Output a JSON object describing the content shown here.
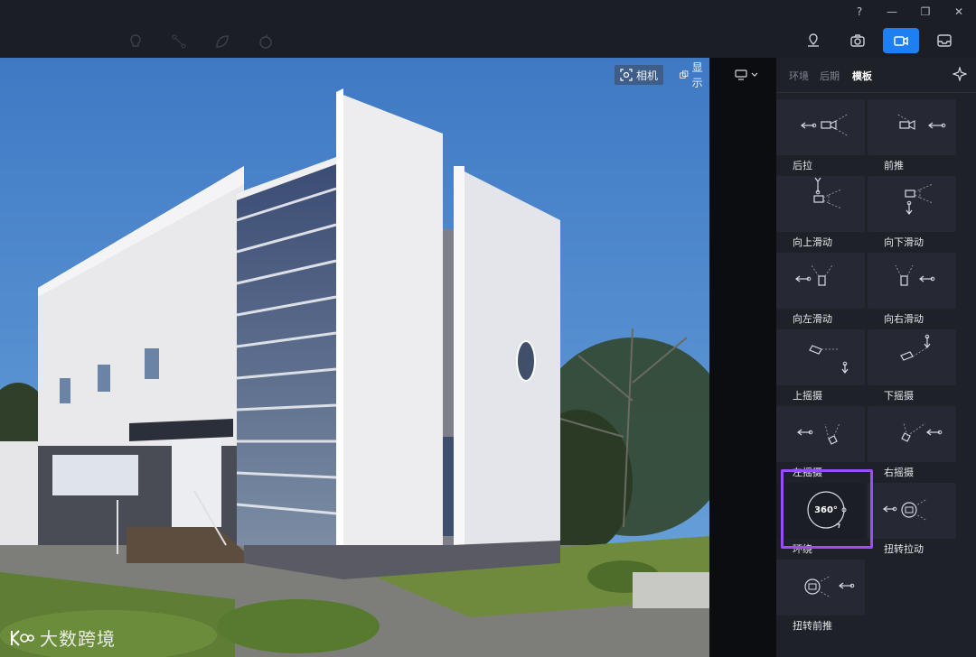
{
  "window": {
    "controls": [
      {
        "name": "help-icon",
        "glyph": "?"
      },
      {
        "name": "minimize-icon",
        "glyph": "—"
      },
      {
        "name": "restore-icon",
        "glyph": "❐"
      },
      {
        "name": "close-icon",
        "glyph": "✕"
      }
    ]
  },
  "toolbar": {
    "faded_tools": [
      "bulb-icon",
      "path-icon",
      "leaf-icon",
      "apple-icon"
    ],
    "modes": [
      {
        "name": "location-mode-button",
        "icon": "map-pin-icon",
        "active": false
      },
      {
        "name": "photo-mode-button",
        "icon": "camera-icon",
        "active": false
      },
      {
        "name": "video-mode-button",
        "icon": "video-camera-icon",
        "active": true
      },
      {
        "name": "inbox-mode-button",
        "icon": "inbox-icon",
        "active": false
      }
    ],
    "accent_color": "#1e7ff2"
  },
  "viewport": {
    "camera_label": "相机",
    "display_label": "显示",
    "watermark": "大数跨境"
  },
  "panel": {
    "tabs": [
      {
        "label": "环境",
        "active": false
      },
      {
        "label": "后期",
        "active": false
      },
      {
        "label": "模板",
        "active": true
      }
    ],
    "templates": [
      {
        "label": "后拉",
        "icon": "pull-back-icon"
      },
      {
        "label": "前推",
        "icon": "push-forward-icon"
      },
      {
        "label": "向上滑动",
        "icon": "slide-up-icon"
      },
      {
        "label": "向下滑动",
        "icon": "slide-down-icon"
      },
      {
        "label": "向左滑动",
        "icon": "slide-left-icon"
      },
      {
        "label": "向右滑动",
        "icon": "slide-right-icon"
      },
      {
        "label": "上摇摄",
        "icon": "tilt-up-icon"
      },
      {
        "label": "下摇摄",
        "icon": "tilt-down-icon"
      },
      {
        "label": "左摇摄",
        "icon": "pan-left-icon"
      },
      {
        "label": "右摇摄",
        "icon": "pan-right-icon"
      },
      {
        "label": "环绕",
        "icon": "orbit-360-icon",
        "badge": "360°",
        "selected": true
      },
      {
        "label": "扭转拉动",
        "icon": "twist-pull-icon"
      },
      {
        "label": "扭转前推",
        "icon": "twist-push-icon"
      }
    ],
    "selection_color": "#9a4dff"
  }
}
